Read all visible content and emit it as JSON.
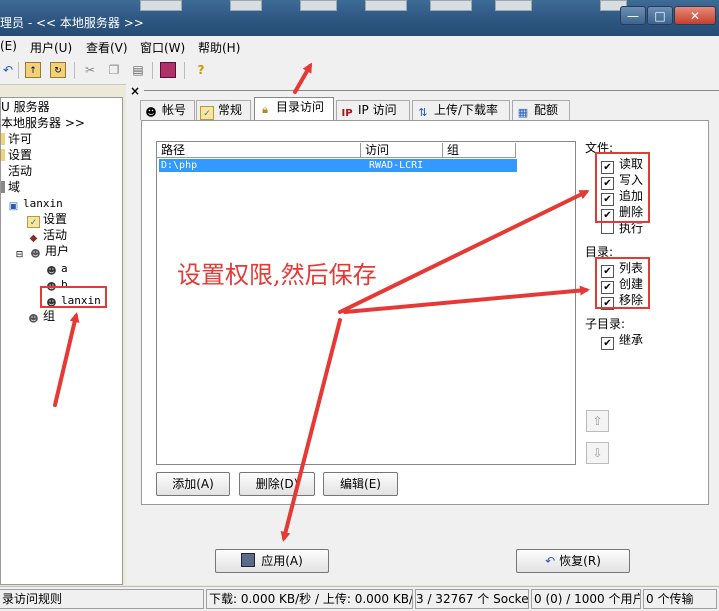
{
  "window": {
    "title": "理员 - << 本地服务器 >>",
    "controls": {
      "minimize": "—",
      "maximize": "□",
      "close": "✕"
    }
  },
  "menu": [
    "(E)",
    "用户(U)",
    "查看(V)",
    "窗口(W)",
    "帮助(H)"
  ],
  "toolbar_icons": [
    "undo-icon",
    "open-folder-icon",
    "refresh-folder-icon",
    "cut-icon",
    "copy-icon",
    "paste-icon",
    "book-icon",
    "help-icon"
  ],
  "tree": {
    "nodes": [
      {
        "label": "U 服务器"
      },
      {
        "label": "本地服务器 >>"
      },
      {
        "label": "许可"
      },
      {
        "label": "设置"
      },
      {
        "label": "活动"
      },
      {
        "label": "域"
      },
      {
        "label": "lanxin"
      },
      {
        "label": "设置"
      },
      {
        "label": "活动"
      },
      {
        "label": "用户"
      },
      {
        "label": "a"
      },
      {
        "label": "b"
      },
      {
        "label": "lanxin"
      },
      {
        "label": "组"
      }
    ]
  },
  "panel": {
    "close": "×"
  },
  "tabs": [
    {
      "label": "帐号"
    },
    {
      "label": "常规"
    },
    {
      "label": "目录访问"
    },
    {
      "label": "IP 访问"
    },
    {
      "label": "上传/下载率"
    },
    {
      "label": "配额"
    }
  ],
  "dir_list": {
    "columns": [
      "路径",
      "访问",
      "组"
    ],
    "rows": [
      {
        "path": "D:\\php",
        "access": "RWAD-LCRI",
        "group": ""
      }
    ]
  },
  "permissions": {
    "files_label": "文件:",
    "files": [
      {
        "label": "读取",
        "checked": true
      },
      {
        "label": "写入",
        "checked": true
      },
      {
        "label": "追加",
        "checked": true
      },
      {
        "label": "删除",
        "checked": true
      },
      {
        "label": "执行",
        "checked": false
      }
    ],
    "dirs_label": "目录:",
    "dirs": [
      {
        "label": "列表",
        "checked": true
      },
      {
        "label": "创建",
        "checked": true
      },
      {
        "label": "移除",
        "checked": true
      }
    ],
    "subdirs_label": "子目录:",
    "subdirs": [
      {
        "label": "继承",
        "checked": true
      }
    ]
  },
  "buttons": {
    "add": "添加(A)",
    "delete": "删除(D)",
    "edit": "编辑(E)",
    "apply": "应用(A)",
    "restore": "恢复(R)"
  },
  "status": {
    "left": "录访问规则",
    "download": "下载: 0.000 KB/秒 / 上传: 0.000 KB/秒",
    "sockets": "3 / 32767 个 Socket",
    "users": "0 (0) / 1000 个用户",
    "transfers": "0 个传输"
  },
  "annotation": {
    "text": "设置权限,然后保存"
  },
  "colors": {
    "accent_red": "#e53935",
    "selection_blue": "#3399ff",
    "titlebar": "#2c557f"
  }
}
